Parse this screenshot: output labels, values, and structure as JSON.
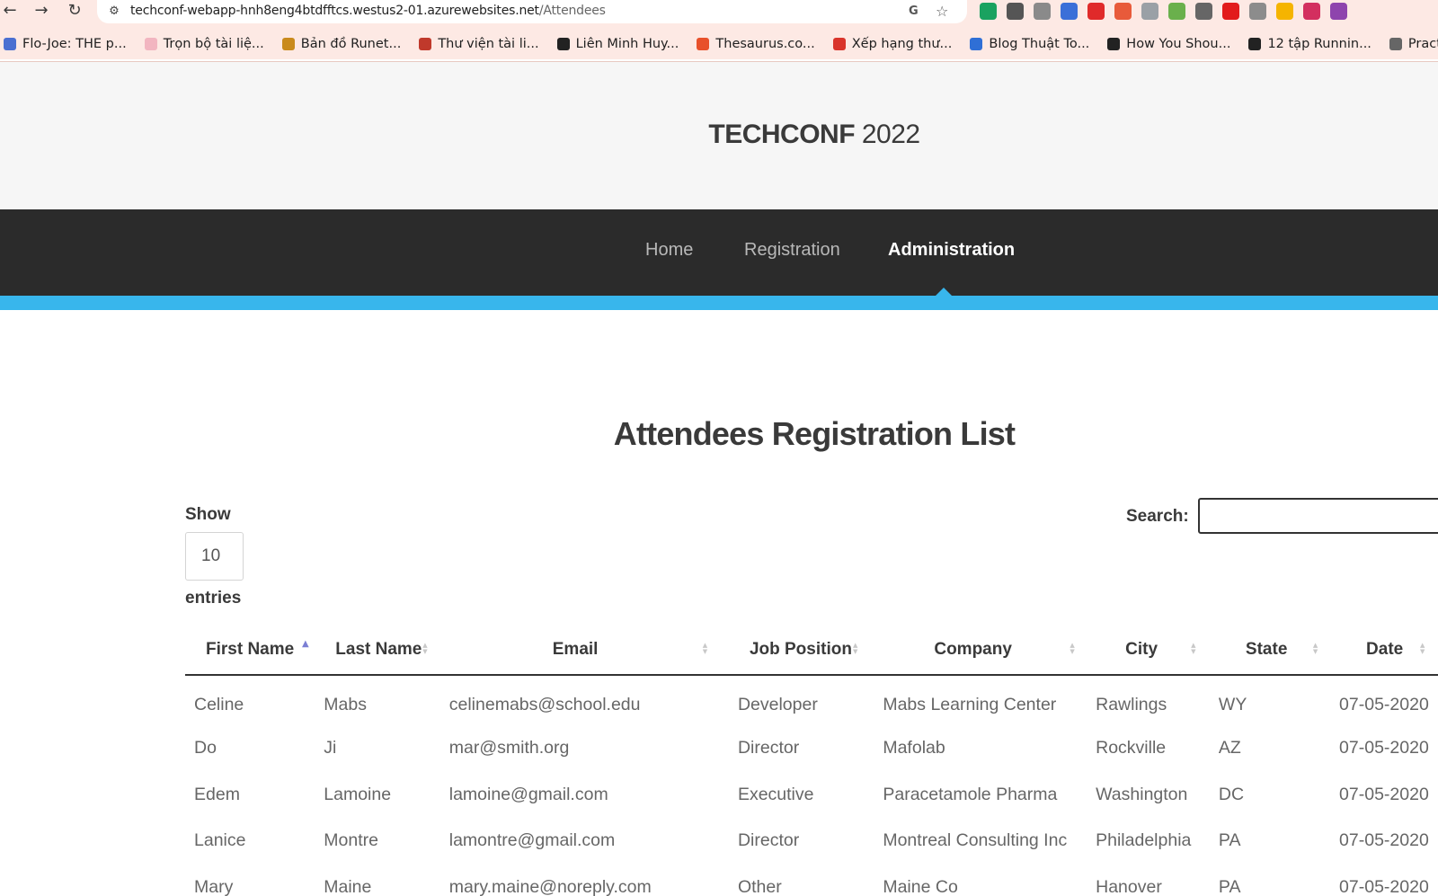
{
  "browser": {
    "back_icon": "←",
    "forward_icon": "→",
    "reload_icon": "↻",
    "site_info_icon": "⚙",
    "url_host": "techconf-webapp-hnh8eng4btdfftcs.westus2-01.azurewebsites.net",
    "url_path": "/Attendees",
    "translate_icon": "G",
    "bookmark_star_icon": "☆",
    "extension_colors": [
      "#1aa260",
      "#555555",
      "#8a8a8a",
      "#3b6fd8",
      "#e02a2a",
      "#e85a3a",
      "#9aa0a6",
      "#6ab04c",
      "#666666",
      "#e21b1b",
      "#8c8c8c",
      "#f5b400",
      "#d32f5f",
      "#8e44ad"
    ],
    "bookmarks": [
      {
        "label": "Flo-Joe: THE p...",
        "color": "#4a6fd1"
      },
      {
        "label": "Trọn bộ tài liệ...",
        "color": "#f2b5c0"
      },
      {
        "label": "Bản đồ Runet...",
        "color": "#c98a1c"
      },
      {
        "label": "Thư viện tài li...",
        "color": "#c0392b"
      },
      {
        "label": "Liên Minh Huy...",
        "color": "#222222"
      },
      {
        "label": "Thesaurus.co...",
        "color": "#e8512b"
      },
      {
        "label": "Xếp hạng thư...",
        "color": "#d9342b"
      },
      {
        "label": "Blog Thuật To...",
        "color": "#2f6fd6"
      },
      {
        "label": "How You Shou...",
        "color": "#222222"
      },
      {
        "label": "12 tập Runnin...",
        "color": "#222222"
      },
      {
        "label": "Pract",
        "color": "#666666"
      }
    ]
  },
  "site": {
    "title_bold": "TECHCONF",
    "title_year": " 2022",
    "nav": [
      {
        "label": "Home",
        "active": false
      },
      {
        "label": "Registration",
        "active": false
      },
      {
        "label": "Administration",
        "active": true
      }
    ]
  },
  "page": {
    "heading": "Attendees Registration List",
    "length_show": "Show",
    "length_value": "10",
    "length_entries": "entries",
    "search_label": "Search:",
    "search_value": ""
  },
  "table": {
    "columns": [
      {
        "label": "First Name",
        "sort": "asc"
      },
      {
        "label": "Last Name",
        "sort": "both"
      },
      {
        "label": "Email",
        "sort": "both"
      },
      {
        "label": "Job Position",
        "sort": "both"
      },
      {
        "label": "Company",
        "sort": "both"
      },
      {
        "label": "City",
        "sort": "both"
      },
      {
        "label": "State",
        "sort": "both"
      },
      {
        "label": "Date",
        "sort": "both"
      }
    ],
    "rows": [
      [
        "Celine",
        "Mabs",
        "celinemabs@school.edu",
        "Developer",
        "Mabs Learning Center",
        "Rawlings",
        "WY",
        "07-05-2020"
      ],
      [
        "Do",
        "Ji",
        "mar@smith.org",
        "Director",
        "Mafolab",
        "Rockville",
        "AZ",
        "07-05-2020"
      ],
      [
        "Edem",
        "Lamoine",
        "lamoine@gmail.com",
        "Executive",
        "Paracetamole Pharma",
        "Washington",
        "DC",
        "07-05-2020"
      ],
      [
        "Lanice",
        "Montre",
        "lamontre@gmail.com",
        "Director",
        "Montreal Consulting Inc",
        "Philadelphia",
        "PA",
        "07-05-2020"
      ],
      [
        "Mary",
        "Maine",
        "mary.maine@noreply.com",
        "Other",
        "Maine Co",
        "Hanover",
        "PA",
        "07-05-2020"
      ]
    ]
  }
}
